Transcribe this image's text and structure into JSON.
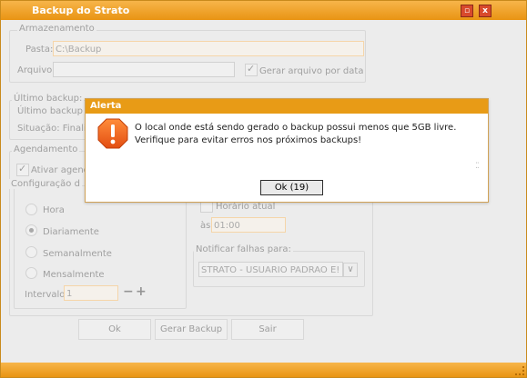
{
  "window": {
    "title": "Backup do Strato",
    "max_icon": "maximize-icon",
    "close_icon": "close-icon"
  },
  "armazenamento": {
    "legend": "Armazenamento",
    "pasta_label": "Pasta:",
    "pasta_value": "C:\\Backup",
    "arquivo_label": "Arquivo:",
    "arquivo_value": "",
    "gerar_por_data_label": "Gerar arquivo por data",
    "gerar_por_data_checked": true
  },
  "ultimo_backup": {
    "legend": "Último backup:",
    "linha1_label": "Último backup fe",
    "situacao_label": "Situação: Finali"
  },
  "agendamento": {
    "legend": "Agendamento",
    "ativar_label": "Ativar agend",
    "ativar_checked": true,
    "configuracao_legend": "Configuração d",
    "frequencias": [
      {
        "label": "Hora",
        "selected": false
      },
      {
        "label": "Diariamente",
        "selected": true
      },
      {
        "label": "Semanalmente",
        "selected": false
      },
      {
        "label": "Mensalmente",
        "selected": false
      }
    ],
    "intervalo_label": "Intervalo",
    "intervalo_value": "1",
    "decrement_label": "−",
    "increment_label": "+",
    "horario_atual_label": "Horário atual",
    "as_label": "às",
    "horario_value": "01:00"
  },
  "notificar": {
    "legend": "Notificar falhas para:",
    "selected": "STRATO - USUARIO PADRAO E!",
    "arrow": "∨"
  },
  "buttons": {
    "ok": "Ok",
    "gerar_backup": "Gerar Backup",
    "sair": "Sair"
  },
  "alert": {
    "title": "Alerta",
    "icon": "warning-icon",
    "message": "O local onde está sendo gerado o backup possui menos que 5GB livre. Verifique para evitar erros nos próximos backups!",
    "ok_button": "Ok (19)"
  }
}
